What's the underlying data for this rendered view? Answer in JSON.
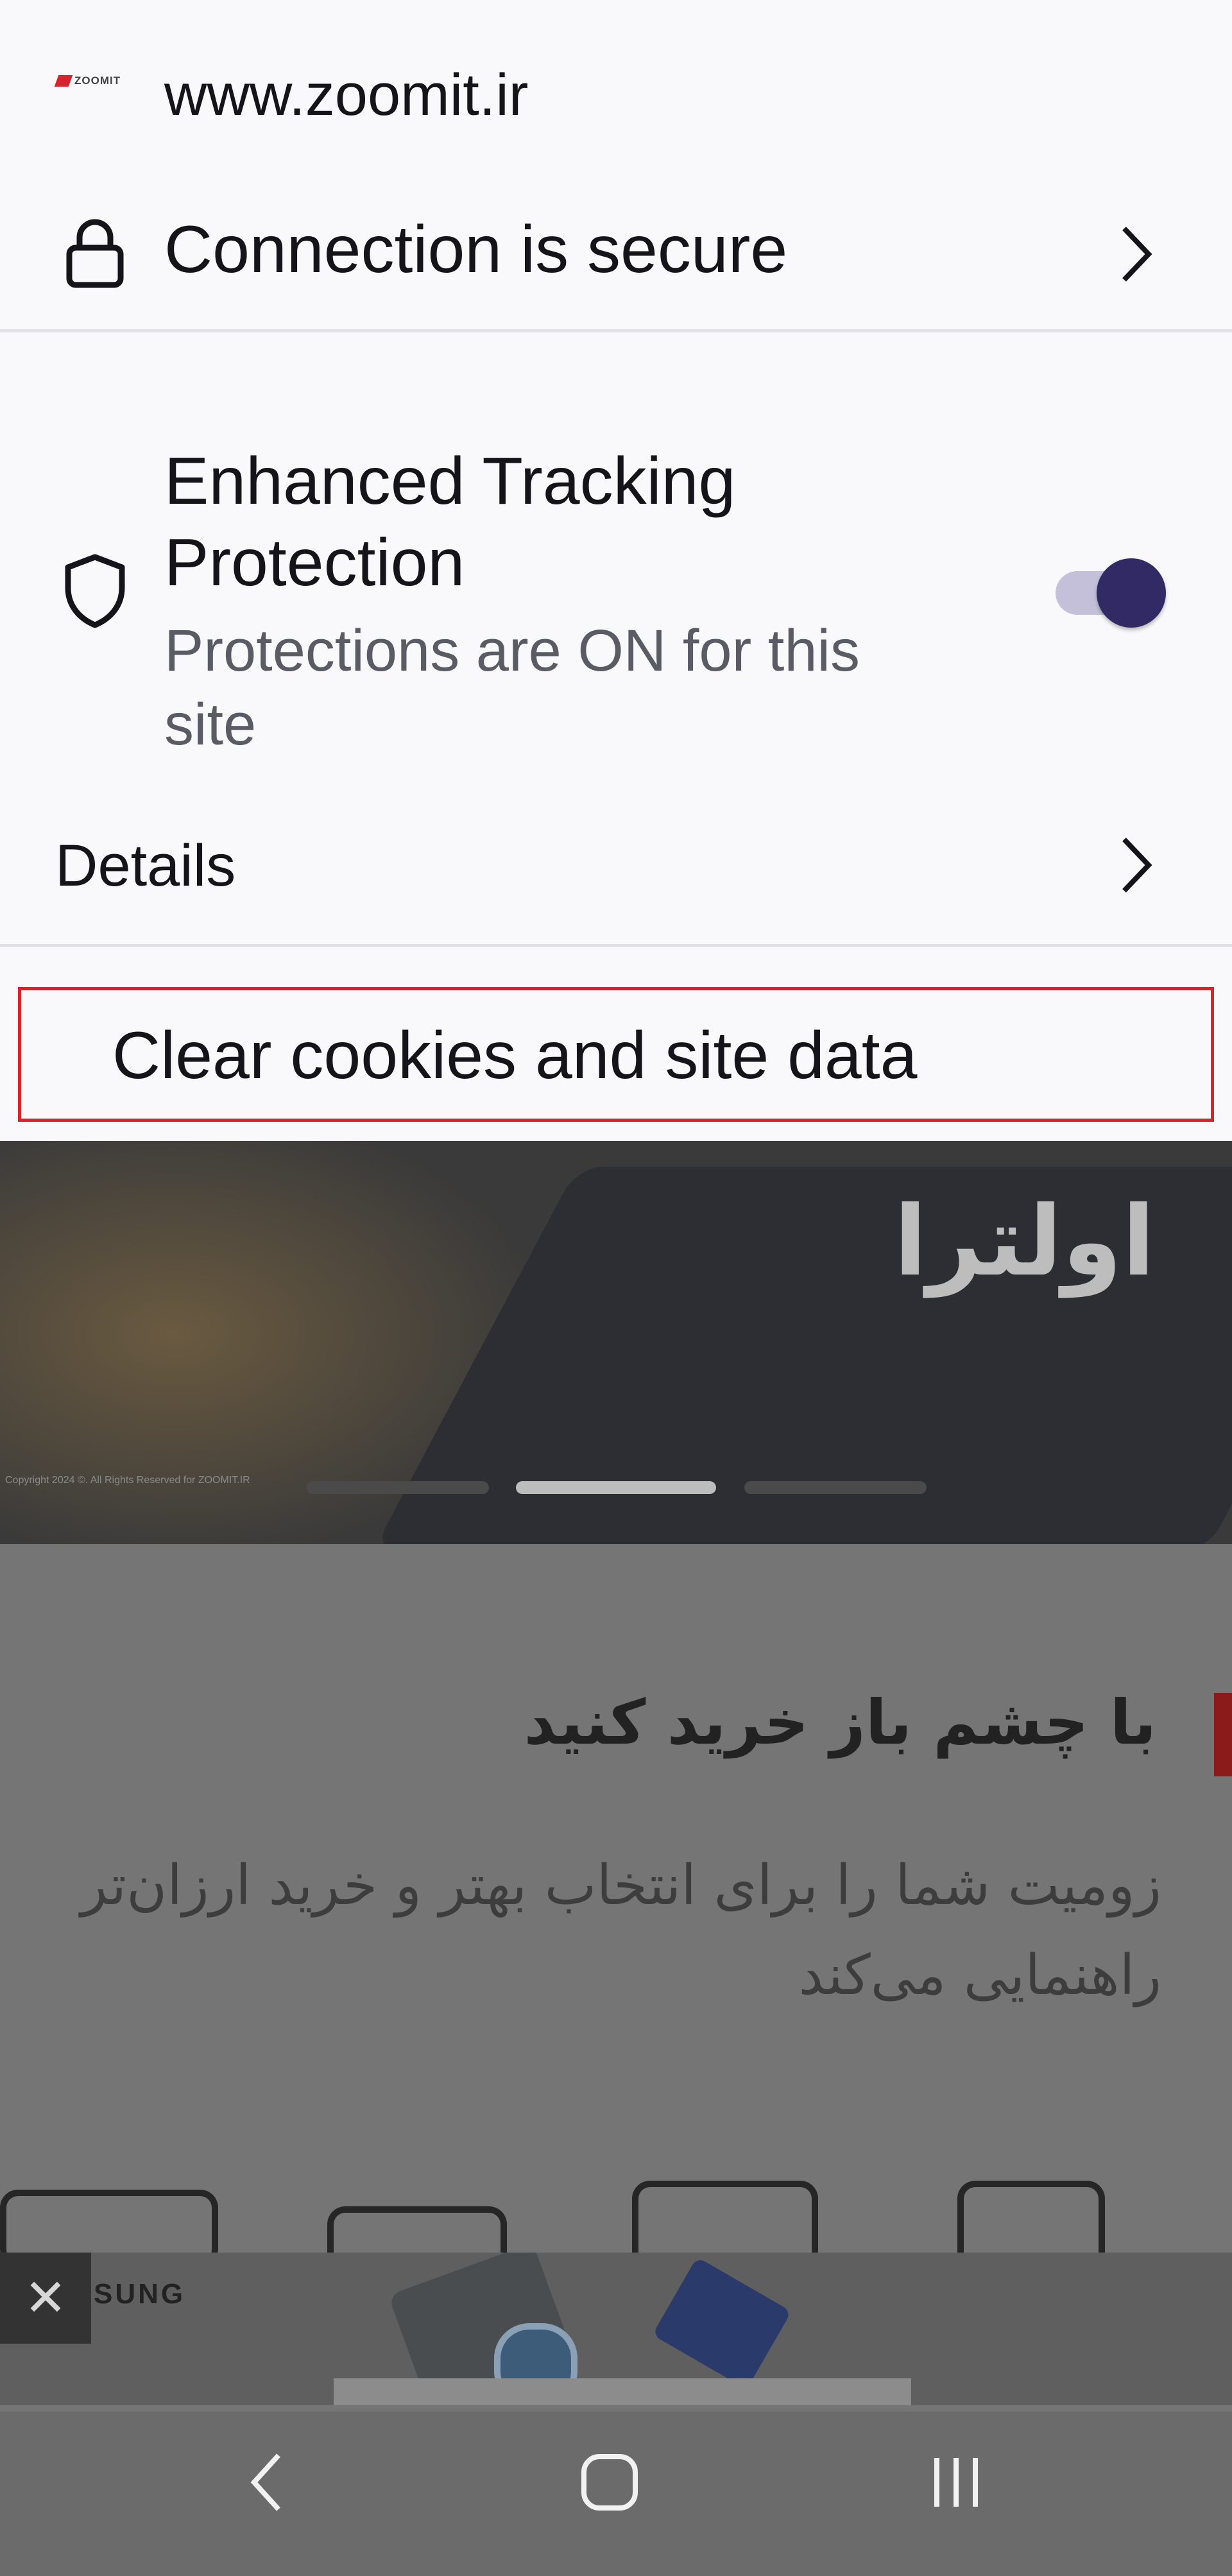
{
  "site": {
    "logo_text": "ZOOMIT",
    "url": "www.zoomit.ir"
  },
  "connection": {
    "label": "Connection is secure",
    "icon": "lock-icon"
  },
  "tracking": {
    "title_line1": "Enhanced Tracking",
    "title_line2": "Protection",
    "status_line1": "Protections are ON for this",
    "status_line2": "site",
    "enabled": true,
    "accent": "#312a65",
    "track": "#c4c0d9"
  },
  "details": {
    "label": "Details"
  },
  "clear": {
    "label": "Clear cookies and site data",
    "highlight": "#d5242e"
  },
  "background": {
    "banner_title": "اولترا",
    "banner_copyright": "Copyright 2024 ©. All Rights Reserved for ZOOMIT.IR",
    "heading": "با چشم باز خرید کنید",
    "paragraph": "زومیت شما را برای انتخاب بهتر و خرید ارزان‌تر راهنمایی می‌کند",
    "ad_brand": "SUNG",
    "ad_close": "✕"
  },
  "navigation": {
    "back": "back-icon",
    "home": "home-icon",
    "recents": "recents-icon"
  }
}
